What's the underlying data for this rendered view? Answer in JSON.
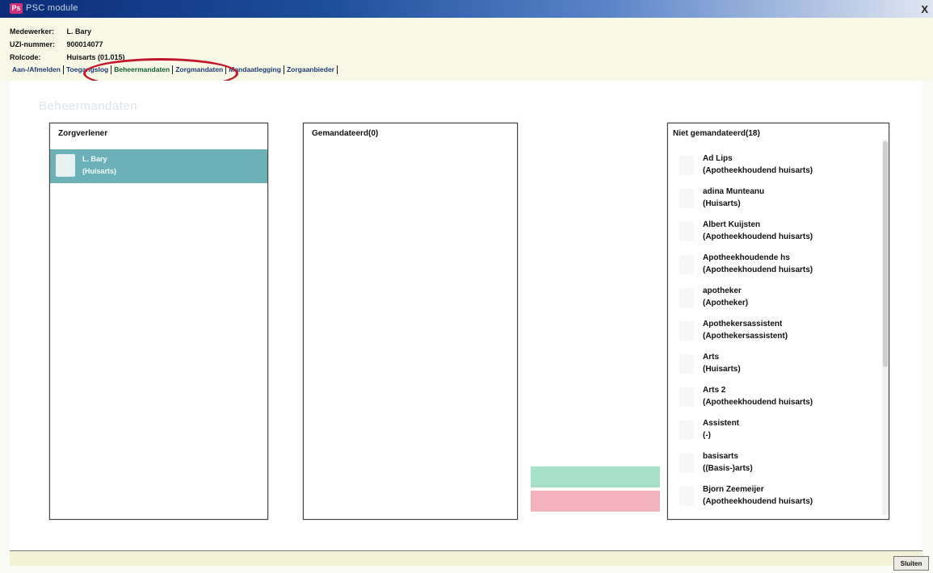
{
  "window": {
    "title": "PSC module",
    "close_glyph": "X"
  },
  "header": {
    "medewerker_label": "Medewerker:",
    "medewerker_value": "L. Bary",
    "uzi_label": "UZI-nummer:",
    "uzi_value": "900014077",
    "rolcode_label": "Rolcode:",
    "rolcode_value": "Huisarts (01.015)"
  },
  "tabs": [
    {
      "label": "Aan-/Afmelden",
      "active": false
    },
    {
      "label": "Toegangslog",
      "active": false
    },
    {
      "label": "Beheermandaten",
      "active": true
    },
    {
      "label": "Zorgmandaten",
      "active": false
    },
    {
      "label": "Mandaatlegging",
      "active": false
    },
    {
      "label": "Zorgaanbieder",
      "active": false
    }
  ],
  "section_title": "Beheermandaten",
  "zorgverlener": {
    "header": "Zorgverlener",
    "selected": {
      "name": "L. Bary",
      "role": "(Huisarts)"
    }
  },
  "gemandateerd": {
    "header": "Gemandateerd(0)",
    "items": []
  },
  "niet_gemandateerd": {
    "header": "Niet gemandateerd(18)",
    "items": [
      {
        "name": "Ad Lips",
        "role": "(Apotheekhoudend huisarts)"
      },
      {
        "name": "adina Munteanu",
        "role": "(Huisarts)"
      },
      {
        "name": "Albert Kuijsten",
        "role": "(Apotheekhoudend huisarts)"
      },
      {
        "name": "Apotheekhoudende hs",
        "role": "(Apotheekhoudend huisarts)"
      },
      {
        "name": "apotheker",
        "role": "(Apotheker)"
      },
      {
        "name": "Apothekersassistent",
        "role": "(Apothekersassistent)"
      },
      {
        "name": "Arts",
        "role": "(Huisarts)"
      },
      {
        "name": "Arts 2",
        "role": "(Apotheekhoudend huisarts)"
      },
      {
        "name": "Assistent",
        "role": "(-)"
      },
      {
        "name": "basisarts",
        "role": "((Basis-)arts)"
      },
      {
        "name": "Bjorn Zeemeijer",
        "role": "(Apotheekhoudend huisarts)"
      }
    ]
  },
  "footer": {
    "close_button": "Sluiten"
  },
  "colors": {
    "selected_row": "#6cb1b8",
    "add_button": "#a7e1c9",
    "remove_button": "#f2b3bd",
    "highlight_oval": "#c0172b"
  }
}
